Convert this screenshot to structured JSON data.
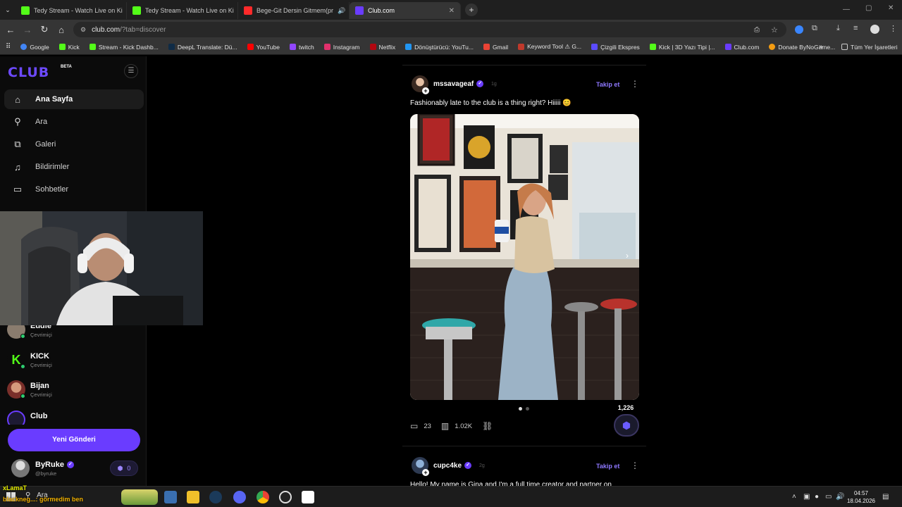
{
  "browser": {
    "tabs": [
      {
        "title": "Tedy Stream - Watch Live on Ki",
        "color": "#53fc18"
      },
      {
        "title": "Tedy Stream - Watch Live on Ki",
        "color": "#53fc18"
      },
      {
        "title": "Bege-Git Dersin Gitmem(pr",
        "color": "#ff2a2a"
      },
      {
        "title": "Club.com",
        "color": "#6a3cff"
      }
    ],
    "url_host": "club.com",
    "url_path": "/?tab=discover",
    "bookmarks": [
      "Google",
      "Kick",
      "Stream - Kick Dashb...",
      "DeepL Translate: Dü...",
      "YouTube",
      "twitch",
      "Instagram",
      "Netflix",
      "Dönüştürücü: YouTu...",
      "Gmail",
      "Keyword Tool ⚠ G...",
      "Çizgili Ekspres",
      "Kick | 3D Yazı Tipi |...",
      "Club.com",
      "Donate ByNoGame..."
    ],
    "all_bookmarks": "Tüm Yer İşaretleri"
  },
  "sidebar": {
    "logo": "CLUB",
    "beta": "BETA",
    "nav": [
      "Ana Sayfa",
      "Ara",
      "Galeri",
      "Bildirimler",
      "Sohbetler"
    ],
    "friends": [
      {
        "name": "Eddie",
        "status": "Çevrimiçi"
      },
      {
        "name": "KICK",
        "status": "Çevrimiçi"
      },
      {
        "name": "Bijan",
        "status": "Çevrimiçi"
      },
      {
        "name": "Club",
        "status": ""
      }
    ],
    "new_post": "Yeni Gönderi",
    "profile": {
      "name": "ByRuke",
      "handle": "@byruke",
      "balance": "0"
    }
  },
  "feed": {
    "posts": [
      {
        "username": "mssavageaf",
        "time": "1g",
        "follow": "Takip et",
        "caption": "Fashionably late to the club is a thing right? Hiiiii 😊",
        "comments": "23",
        "views": "1.02K",
        "tips": "1,226"
      },
      {
        "username": "cupc4ke",
        "time": "2g",
        "follow": "Takip et",
        "caption": "Hello! My name is Gina and I'm a full time creator and partner on"
      }
    ]
  },
  "taskbar": {
    "search_text": "Ara",
    "overlay_name": "xLamaT",
    "overlay_chat": "blackneg...: görmedim ben",
    "time": "04:57",
    "date": "18.04.2026"
  }
}
